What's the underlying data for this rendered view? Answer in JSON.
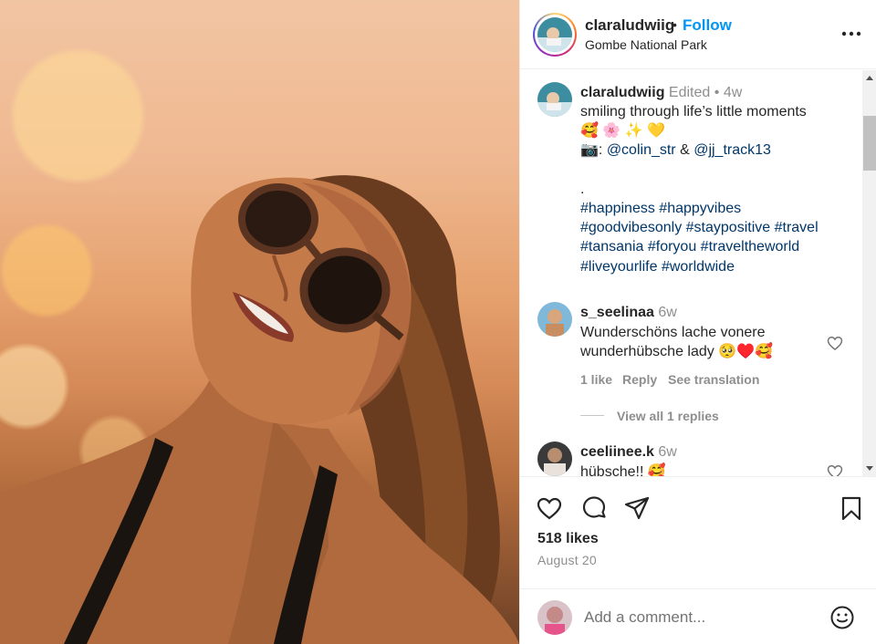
{
  "post": {
    "username": "claraludwiig",
    "dot": "•",
    "follow_label": "Follow",
    "location": "Gombe National Park"
  },
  "caption": {
    "username": "claraludwiig",
    "edited": "Edited",
    "dot": "•",
    "age": "4w",
    "line1": "smiling through life’s little moments",
    "emoji_line": "🥰 🌸 ✨ 💛",
    "camera": "📷",
    "colon": ": ",
    "mention1": "@colin_str",
    "amp": " & ",
    "mention2": "@jj_track13",
    "dot_line": ".",
    "hashtags": [
      [
        "#happiness",
        "#happyvibes"
      ],
      [
        "#goodvibesonly",
        "#staypositive",
        "#travel"
      ],
      [
        "#tansania",
        "#foryou",
        "#traveltheworld"
      ],
      [
        "#liveyourlife",
        "#worldwide"
      ]
    ]
  },
  "comments": [
    {
      "username": "s_seelinaa",
      "age": "6w",
      "text1": "Wunderschöns lache vonere",
      "text2": "wunderhübsche lady 🥺♥️🥰",
      "likes": "1 like",
      "reply": "Reply",
      "translate": "See translation",
      "view_replies": "View all 1 replies"
    },
    {
      "username": "ceeliinee.k",
      "age": "6w",
      "text1": "hübsche!! 🥰"
    }
  ],
  "likes_count": "518 likes",
  "date": "August 20",
  "add_comment": {
    "placeholder": "Add a comment..."
  },
  "icons": {
    "like": "heart-icon",
    "comment": "comment-bubble-icon",
    "share": "paper-plane-icon",
    "save": "bookmark-icon",
    "more": "more-horizontal-icon",
    "emoji": "smiley-icon"
  },
  "colors": {
    "link": "#0095f6",
    "hashtag": "#00376b",
    "muted": "#8e8e8e"
  }
}
